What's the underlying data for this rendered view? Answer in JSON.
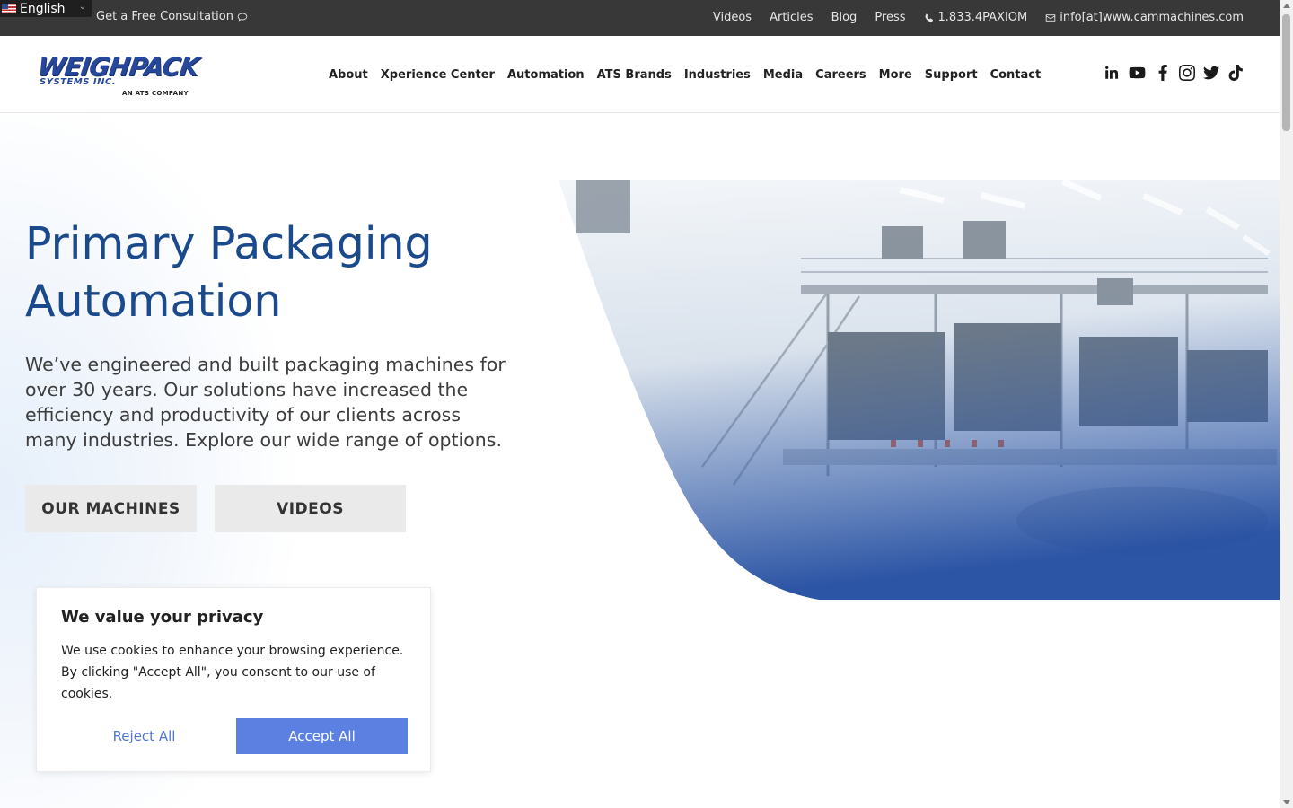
{
  "topbar": {
    "language": "English",
    "consultation": "Get a Free Consultation",
    "links": [
      "Videos",
      "Articles",
      "Blog",
      "Press"
    ],
    "phone": "1.833.4PAXIOM",
    "email": "info[at]www.cammachines.com"
  },
  "header": {
    "logo": {
      "brand": "WEIGHPACK",
      "subtitle": "SYSTEMS INC.",
      "tagline": "AN ATS COMPANY"
    },
    "nav": [
      "About",
      "Xperience Center",
      "Automation",
      "ATS Brands",
      "Industries",
      "Media",
      "Careers",
      "More",
      "Support",
      "Contact"
    ],
    "social_icons": [
      "linkedin-icon",
      "youtube-icon",
      "facebook-icon",
      "instagram-icon",
      "twitter-icon",
      "tiktok-icon"
    ]
  },
  "hero": {
    "title": "Primary Packaging Automation",
    "text": "We’ve engineered and built packaging machines for over 30 years. Our solutions have increased the efficiency and productivity of our clients across many industries. Explore our wide range of options.",
    "buttons": {
      "machines": "OUR MACHINES",
      "videos": "VIDEOS"
    }
  },
  "cookie": {
    "title": "We value your privacy",
    "text": "We use cookies to enhance your browsing experience. By clicking \"Accept All\", you consent to our use of cookies.",
    "reject": "Reject All",
    "accept": "Accept All"
  },
  "colors": {
    "brand_blue": "#1a4a8c",
    "accept_blue": "#5b80e2",
    "topbar": "#383838"
  }
}
